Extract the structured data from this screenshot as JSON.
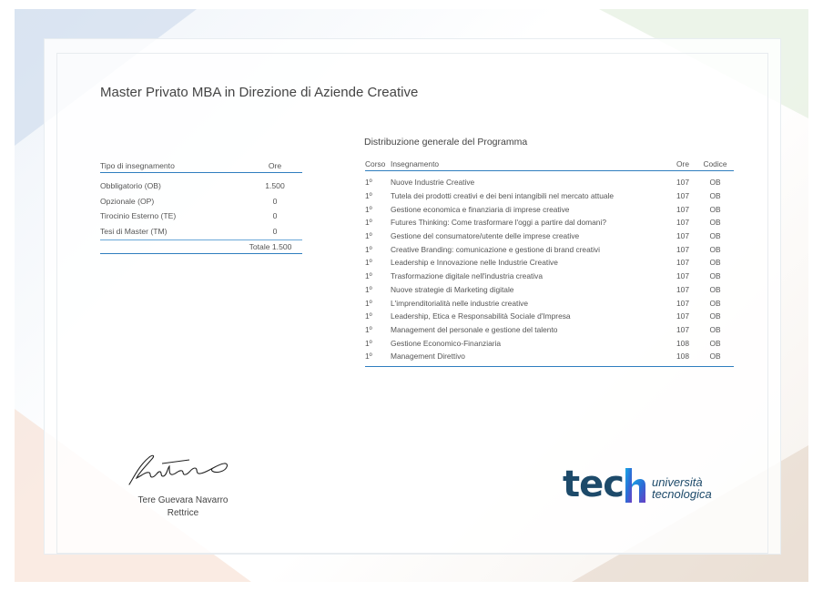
{
  "certificate": {
    "title": "Master Privato MBA in Direzione di Aziende Creative"
  },
  "hours_table": {
    "headers": {
      "type": "Tipo di insegnamento",
      "hours": "Ore"
    },
    "rows": [
      {
        "type": "Obbligatorio (OB)",
        "hours": "1.500"
      },
      {
        "type": "Opzionale (OP)",
        "hours": "0"
      },
      {
        "type": "Tirocinio Esterno (TE)",
        "hours": "0"
      },
      {
        "type": "Tesi di Master (TM)",
        "hours": "0"
      }
    ],
    "total": "Totale 1.500"
  },
  "program": {
    "title": "Distribuzione generale del Programma",
    "headers": {
      "course": "Corso",
      "subject": "Insegnamento",
      "hours": "Ore",
      "code": "Codice"
    },
    "rows": [
      {
        "course": "1º",
        "subject": "Nuove Industrie Creative",
        "hours": "107",
        "code": "OB"
      },
      {
        "course": "1º",
        "subject": "Tutela dei prodotti creativi e dei beni intangibili nel mercato attuale",
        "hours": "107",
        "code": "OB"
      },
      {
        "course": "1º",
        "subject": "Gestione economica e finanziaria di imprese creative",
        "hours": "107",
        "code": "OB"
      },
      {
        "course": "1º",
        "subject": "Futures Thinking: Come trasformare l'oggi a partire dal domani?",
        "hours": "107",
        "code": "OB"
      },
      {
        "course": "1º",
        "subject": "Gestione del consumatore/utente delle imprese creative",
        "hours": "107",
        "code": "OB"
      },
      {
        "course": "1º",
        "subject": "Creative Branding: comunicazione e gestione di brand creativi",
        "hours": "107",
        "code": "OB"
      },
      {
        "course": "1º",
        "subject": "Leadership e Innovazione nelle Industrie Creative",
        "hours": "107",
        "code": "OB"
      },
      {
        "course": "1º",
        "subject": "Trasformazione digitale nell'industria creativa",
        "hours": "107",
        "code": "OB"
      },
      {
        "course": "1º",
        "subject": "Nuove strategie di Marketing digitale",
        "hours": "107",
        "code": "OB"
      },
      {
        "course": "1º",
        "subject": "L'imprenditorialità nelle industrie creative",
        "hours": "107",
        "code": "OB"
      },
      {
        "course": "1º",
        "subject": "Leadership, Etica e Responsabilità Sociale d'Impresa",
        "hours": "107",
        "code": "OB"
      },
      {
        "course": "1º",
        "subject": "Management del personale e gestione del talento",
        "hours": "107",
        "code": "OB"
      },
      {
        "course": "1º",
        "subject": "Gestione Economico-Finanziaria",
        "hours": "108",
        "code": "OB"
      },
      {
        "course": "1º",
        "subject": "Management Direttivo",
        "hours": "108",
        "code": "OB"
      }
    ]
  },
  "signer": {
    "name": "Tere Guevara Navarro",
    "role": "Rettrice"
  },
  "logo": {
    "word": "tec",
    "line1": "università",
    "line2": "tecnologica"
  },
  "colors": {
    "accent": "#2f7ebf",
    "logo": "#1d4a6a"
  }
}
